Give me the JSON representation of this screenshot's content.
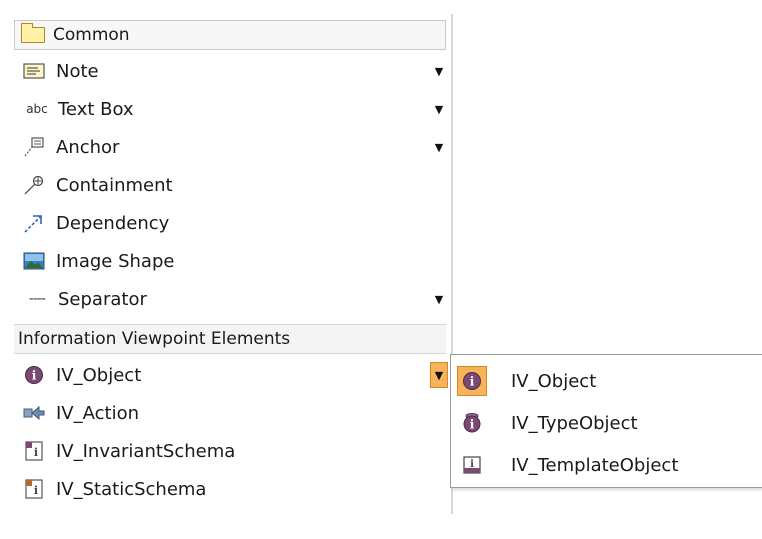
{
  "palette": {
    "common_group": {
      "label": "Common"
    },
    "common_items": [
      {
        "label": "Note",
        "icon": "note-icon",
        "has_menu": true
      },
      {
        "label": "Text Box",
        "icon_text": "abc",
        "icon": "text-box-icon",
        "has_menu": true
      },
      {
        "label": "Anchor",
        "icon": "anchor-icon",
        "has_menu": true
      },
      {
        "label": "Containment",
        "icon": "containment-icon",
        "has_menu": false
      },
      {
        "label": "Dependency",
        "icon": "dependency-icon",
        "has_menu": false
      },
      {
        "label": "Image Shape",
        "icon": "image-shape-icon",
        "has_menu": false
      },
      {
        "label": "Separator",
        "icon_text": "----",
        "icon": "separator-icon",
        "has_menu": true
      }
    ],
    "info_group": {
      "label": "Information Viewpoint Elements"
    },
    "info_items": [
      {
        "label": "IV_Object",
        "icon": "iv-object-icon",
        "has_menu": true,
        "menu_open": true
      },
      {
        "label": "IV_Action",
        "icon": "iv-action-icon",
        "has_menu": false
      },
      {
        "label": "IV_InvariantSchema",
        "icon": "iv-invariant-schema-icon",
        "has_menu": false
      },
      {
        "label": "IV_StaticSchema",
        "icon": "iv-static-schema-icon",
        "has_menu": false
      }
    ]
  },
  "popup": {
    "items": [
      {
        "label": "IV_Object",
        "icon": "iv-object-icon",
        "selected": true
      },
      {
        "label": "IV_TypeObject",
        "icon": "iv-type-object-icon",
        "selected": false
      },
      {
        "label": "IV_TemplateObject",
        "icon": "iv-template-object-icon",
        "selected": false
      }
    ]
  },
  "colors": {
    "highlight": "#f7b25a",
    "highlight_border": "#d18a2b",
    "folder_fill": "#fff1a8",
    "dependency_arrow": "#2f5fc8",
    "iv_icon": "#7a4a73"
  },
  "glyphs": {
    "dropdown_arrow": "▼"
  }
}
